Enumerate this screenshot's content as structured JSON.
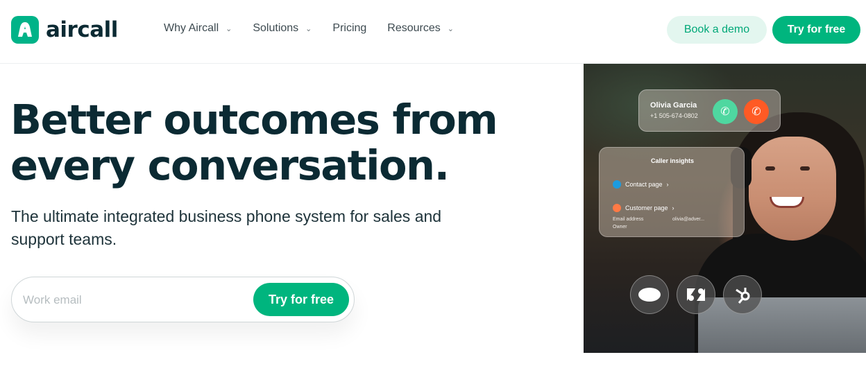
{
  "brand": {
    "name": "aircall",
    "accent": "#00b57e"
  },
  "nav": {
    "items": [
      {
        "label": "Why Aircall",
        "has_dropdown": true
      },
      {
        "label": "Solutions",
        "has_dropdown": true
      },
      {
        "label": "Pricing",
        "has_dropdown": false
      },
      {
        "label": "Resources",
        "has_dropdown": true
      }
    ]
  },
  "header_actions": {
    "demo_label": "Book a demo",
    "try_label": "Try for free"
  },
  "hero": {
    "title_line1": "Better outcomes from",
    "title_line2": "every conversation.",
    "subtitle": "The ultimate integrated business phone system for sales and support teams."
  },
  "signup": {
    "email_placeholder": "Work email",
    "submit_label": "Try for free"
  },
  "photo_overlay": {
    "call": {
      "name": "Olivia Garcia",
      "number": "+1 505-674-0802"
    },
    "insights": {
      "title": "Caller insights",
      "contact_label": "Contact page",
      "customer_label": "Customer page",
      "email_label": "Email address",
      "email_value": "olivia@adver...",
      "owner_label": "Owner"
    },
    "integrations": [
      "salesforce",
      "zendesk",
      "hubspot"
    ]
  }
}
